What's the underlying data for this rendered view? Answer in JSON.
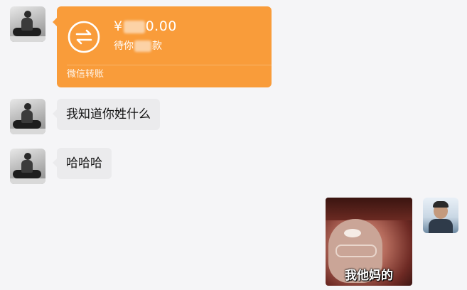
{
  "messages": {
    "transfer": {
      "amount_prefix": "¥",
      "amount_suffix": "0.00",
      "status_prefix": "待你",
      "status_suffix": "款",
      "label": "微信转账",
      "icon": "transfer-arrows-icon",
      "color": "#f99c3a"
    },
    "text1": "我知道你姓什么",
    "text2": "哈哈哈",
    "sticker_caption": "我他妈的"
  }
}
